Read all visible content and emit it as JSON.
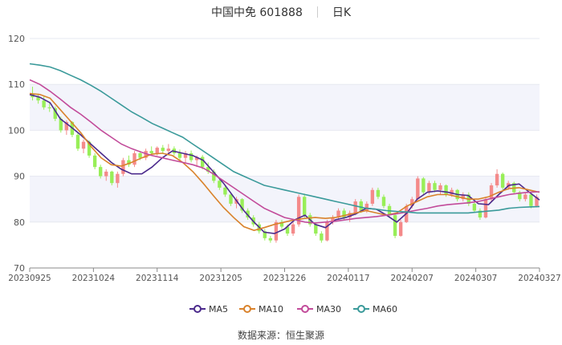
{
  "header": {
    "title": "中国中免 601888",
    "period": "日K"
  },
  "source_text": "数据来源：恒生聚源",
  "chart_data": {
    "type": "candlestick",
    "ylim": [
      70,
      120
    ],
    "yticks": [
      70,
      80,
      90,
      100,
      110,
      120
    ],
    "xticks": [
      "20230925",
      "20231024",
      "20231114",
      "20231205",
      "20231226",
      "20240117",
      "20240207",
      "20240307",
      "20240327"
    ],
    "colors": {
      "up": "#f48a8a",
      "down": "#98ee58",
      "MA5": "#4b2a8c",
      "MA10": "#d9822b",
      "MA30": "#c24b9a",
      "MA60": "#3a9a9a"
    },
    "legend": [
      "MA5",
      "MA10",
      "MA30",
      "MA60"
    ],
    "ohlc": [
      [
        108.0,
        109.5,
        106.5,
        107.2
      ],
      [
        107.2,
        108.0,
        105.8,
        106.5
      ],
      [
        106.5,
        107.4,
        104.5,
        105.0
      ],
      [
        105.0,
        106.2,
        104.0,
        104.8
      ],
      [
        104.8,
        105.2,
        102.0,
        102.5
      ],
      [
        102.5,
        103.0,
        99.5,
        100.0
      ],
      [
        100.0,
        102.2,
        99.0,
        101.8
      ],
      [
        101.8,
        102.0,
        98.5,
        99.0
      ],
      [
        99.0,
        99.5,
        95.5,
        96.0
      ],
      [
        96.0,
        98.0,
        95.0,
        97.5
      ],
      [
        97.5,
        97.8,
        94.0,
        94.5
      ],
      [
        94.5,
        95.0,
        91.5,
        92.0
      ],
      [
        92.0,
        92.5,
        89.5,
        90.0
      ],
      [
        90.0,
        91.5,
        89.0,
        91.0
      ],
      [
        91.0,
        91.2,
        88.0,
        88.5
      ],
      [
        88.5,
        91.0,
        87.5,
        90.5
      ],
      [
        90.5,
        94.0,
        90.0,
        93.5
      ],
      [
        93.5,
        94.5,
        92.0,
        92.5
      ],
      [
        92.5,
        95.5,
        92.0,
        95.0
      ],
      [
        95.0,
        95.5,
        93.5,
        94.0
      ],
      [
        94.0,
        96.0,
        93.5,
        95.5
      ],
      [
        95.5,
        96.5,
        94.5,
        95.0
      ],
      [
        95.0,
        96.5,
        94.5,
        96.2
      ],
      [
        96.2,
        96.8,
        95.0,
        95.5
      ],
      [
        95.5,
        97.0,
        95.0,
        96.0
      ],
      [
        96.0,
        96.5,
        94.5,
        95.0
      ],
      [
        95.0,
        95.8,
        93.5,
        94.0
      ],
      [
        94.0,
        95.5,
        93.0,
        95.0
      ],
      [
        95.0,
        95.6,
        93.0,
        93.5
      ],
      [
        93.5,
        94.5,
        92.0,
        94.2
      ],
      [
        94.2,
        94.6,
        91.5,
        92.0
      ],
      [
        92.0,
        93.0,
        90.5,
        91.0
      ],
      [
        91.0,
        91.5,
        88.5,
        89.0
      ],
      [
        89.0,
        89.5,
        87.0,
        87.5
      ],
      [
        87.5,
        88.0,
        85.5,
        86.0
      ],
      [
        86.0,
        86.5,
        83.5,
        84.0
      ],
      [
        84.0,
        85.5,
        83.0,
        85.0
      ],
      [
        85.0,
        85.2,
        82.0,
        82.5
      ],
      [
        82.5,
        83.0,
        80.5,
        81.0
      ],
      [
        81.0,
        81.5,
        79.0,
        79.5
      ],
      [
        79.5,
        80.0,
        77.5,
        78.0
      ],
      [
        78.0,
        78.5,
        76.0,
        76.5
      ],
      [
        76.5,
        77.0,
        75.5,
        76.0
      ],
      [
        76.0,
        80.5,
        75.5,
        80.0
      ],
      [
        80.0,
        80.5,
        78.5,
        79.0
      ],
      [
        79.0,
        79.5,
        77.0,
        77.5
      ],
      [
        77.5,
        80.0,
        77.0,
        79.5
      ],
      [
        79.5,
        86.0,
        79.0,
        85.5
      ],
      [
        85.5,
        86.2,
        81.0,
        81.5
      ],
      [
        81.5,
        82.0,
        79.0,
        79.5
      ],
      [
        79.5,
        80.0,
        77.0,
        77.5
      ],
      [
        77.5,
        78.0,
        75.5,
        76.0
      ],
      [
        76.0,
        80.5,
        75.8,
        80.0
      ],
      [
        80.0,
        81.5,
        79.5,
        81.0
      ],
      [
        81.0,
        83.0,
        80.5,
        82.5
      ],
      [
        82.5,
        83.0,
        80.5,
        81.0
      ],
      [
        81.0,
        82.5,
        80.0,
        82.0
      ],
      [
        82.0,
        85.0,
        81.5,
        84.5
      ],
      [
        84.5,
        85.0,
        82.0,
        82.5
      ],
      [
        82.5,
        84.5,
        82.0,
        84.0
      ],
      [
        84.0,
        87.5,
        83.5,
        87.0
      ],
      [
        87.0,
        87.5,
        85.0,
        85.5
      ],
      [
        85.5,
        86.0,
        83.0,
        83.5
      ],
      [
        83.5,
        84.0,
        81.0,
        81.5
      ],
      [
        81.5,
        82.0,
        76.5,
        77.0
      ],
      [
        77.0,
        80.5,
        76.8,
        80.0
      ],
      [
        80.0,
        84.0,
        79.8,
        83.5
      ],
      [
        83.5,
        85.5,
        83.0,
        85.0
      ],
      [
        85.0,
        90.0,
        84.5,
        89.5
      ],
      [
        89.5,
        89.8,
        86.0,
        86.5
      ],
      [
        86.5,
        89.0,
        86.0,
        88.5
      ],
      [
        88.5,
        89.0,
        86.5,
        87.0
      ],
      [
        87.0,
        88.5,
        86.0,
        88.0
      ],
      [
        88.0,
        88.2,
        85.5,
        86.0
      ],
      [
        86.0,
        87.5,
        85.5,
        87.0
      ],
      [
        87.0,
        87.2,
        84.5,
        85.0
      ],
      [
        85.0,
        86.5,
        84.5,
        86.0
      ],
      [
        86.0,
        86.5,
        83.5,
        84.0
      ],
      [
        84.0,
        84.5,
        82.0,
        82.5
      ],
      [
        82.5,
        83.0,
        80.5,
        81.0
      ],
      [
        81.0,
        85.5,
        80.8,
        85.0
      ],
      [
        85.0,
        88.5,
        84.5,
        88.0
      ],
      [
        88.0,
        91.5,
        87.5,
        90.5
      ],
      [
        90.5,
        90.8,
        87.0,
        87.5
      ],
      [
        87.5,
        89.0,
        87.0,
        88.5
      ],
      [
        88.5,
        88.8,
        86.0,
        86.5
      ],
      [
        86.5,
        86.8,
        84.5,
        85.0
      ],
      [
        85.0,
        86.5,
        84.5,
        86.0
      ],
      [
        86.0,
        86.2,
        83.0,
        83.5
      ],
      [
        83.5,
        86.0,
        83.2,
        85.5
      ]
    ],
    "ma": {
      "MA5": [
        107.8,
        107.2,
        106.0,
        102.5,
        100.8,
        99.0,
        97.0,
        95.0,
        93.0,
        91.5,
        90.5,
        90.5,
        92.0,
        94.0,
        95.5,
        95.0,
        94.5,
        93.5,
        91.0,
        88.5,
        85.5,
        82.5,
        80.0,
        77.8,
        77.5,
        78.5,
        80.5,
        81.5,
        79.5,
        78.8,
        80.5,
        81.0,
        81.8,
        83.0,
        82.8,
        81.5,
        80.0,
        82.0,
        85.0,
        86.5,
        86.8,
        86.5,
        86.0,
        85.8,
        84.0,
        83.8,
        86.0,
        88.0,
        88.3,
        86.5,
        84.8
      ],
      "MA10": [
        108.0,
        107.8,
        107.0,
        104.5,
        102.0,
        99.5,
        96.5,
        94.0,
        92.5,
        92.2,
        93.0,
        94.0,
        94.8,
        95.0,
        94.5,
        93.0,
        91.0,
        88.5,
        85.8,
        83.2,
        81.0,
        79.0,
        78.2,
        78.8,
        79.5,
        80.0,
        80.5,
        80.8,
        81.0,
        80.8,
        81.0,
        81.5,
        82.0,
        82.5,
        82.0,
        81.5,
        82.0,
        83.5,
        84.5,
        85.5,
        86.0,
        86.0,
        85.5,
        85.0,
        85.0,
        85.5,
        86.5,
        87.3,
        87.5,
        87.0,
        86.5
      ],
      "MA30": [
        111.0,
        110.0,
        108.5,
        106.8,
        105.0,
        103.5,
        101.8,
        100.0,
        98.5,
        97.0,
        96.0,
        95.2,
        94.5,
        94.0,
        93.5,
        93.0,
        92.5,
        91.8,
        90.5,
        89.0,
        87.5,
        86.0,
        84.5,
        83.0,
        82.0,
        81.0,
        80.5,
        80.0,
        79.8,
        80.0,
        80.2,
        80.5,
        80.8,
        81.0,
        81.2,
        81.5,
        81.8,
        82.2,
        82.6,
        83.0,
        83.5,
        83.8,
        84.0,
        84.2,
        84.5,
        85.0,
        85.5,
        86.0,
        86.3,
        86.5,
        86.6
      ],
      "MA60": [
        114.5,
        114.2,
        113.8,
        113.0,
        112.0,
        111.0,
        109.8,
        108.5,
        107.0,
        105.5,
        104.0,
        102.8,
        101.5,
        100.5,
        99.5,
        98.5,
        97.0,
        95.5,
        94.0,
        92.5,
        91.0,
        90.0,
        89.0,
        88.0,
        87.5,
        87.0,
        86.5,
        86.0,
        85.5,
        85.0,
        84.5,
        84.0,
        83.5,
        83.0,
        82.8,
        82.5,
        82.3,
        82.2,
        82.0,
        82.0,
        82.0,
        82.0,
        82.0,
        82.0,
        82.2,
        82.4,
        82.6,
        83.0,
        83.2,
        83.3,
        83.4
      ]
    }
  }
}
